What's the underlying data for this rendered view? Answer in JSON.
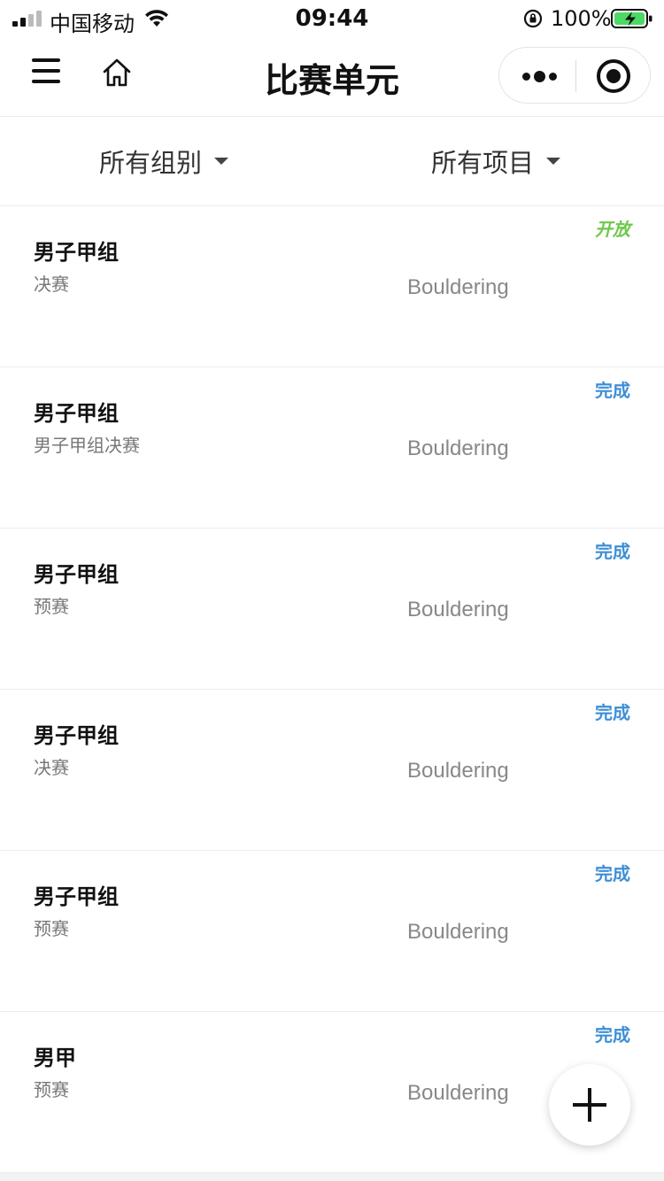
{
  "status_bar": {
    "carrier": "中国移动",
    "time": "09:44",
    "battery_percent": "100%",
    "battery_color": "#4cd964",
    "icons": [
      "signal-icon",
      "wifi-icon",
      "rotation-lock-icon",
      "battery-charging-icon"
    ]
  },
  "nav": {
    "title": "比赛单元",
    "icons": [
      "menu-icon",
      "home-icon",
      "more-icon",
      "close-target-icon"
    ]
  },
  "filters": {
    "group_label": "所有组别",
    "event_label": "所有项目"
  },
  "items": [
    {
      "title": "男子甲组",
      "subtitle": "决赛",
      "sport": "Bouldering",
      "status": "开放",
      "status_type": "open"
    },
    {
      "title": "男子甲组",
      "subtitle": "男子甲组决赛",
      "sport": "Bouldering",
      "status": "完成",
      "status_type": "done"
    },
    {
      "title": "男子甲组",
      "subtitle": "预赛",
      "sport": "Bouldering",
      "status": "完成",
      "status_type": "done"
    },
    {
      "title": "男子甲组",
      "subtitle": "决赛",
      "sport": "Bouldering",
      "status": "完成",
      "status_type": "done"
    },
    {
      "title": "男子甲组",
      "subtitle": "预赛",
      "sport": "Bouldering",
      "status": "完成",
      "status_type": "done"
    },
    {
      "title": "男甲",
      "subtitle": "预赛",
      "sport": "Bouldering",
      "status": "完成",
      "status_type": "done"
    }
  ],
  "colors": {
    "open": "#6ec84b",
    "done": "#3f8fd6"
  },
  "fab_icon": "plus-icon"
}
